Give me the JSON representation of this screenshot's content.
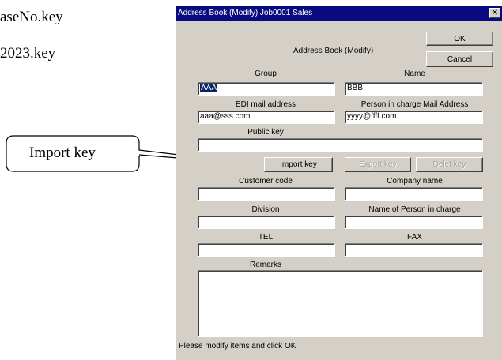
{
  "background": {
    "line1": "aseNo.key",
    "line2": "2023.key",
    "callout_label": "Import key"
  },
  "window": {
    "title": "Address Book (Modify) Job0001 Sales",
    "close_glyph": "✕",
    "heading": "Address Book (Modify)",
    "ok_label": "OK",
    "cancel_label": "Cancel"
  },
  "form": {
    "group": {
      "label": "Group",
      "value": "AAA",
      "selected": true
    },
    "name": {
      "label": "Name",
      "value": "BBB"
    },
    "edi_mail": {
      "label": "EDI mail address",
      "value": "aaa@sss.com"
    },
    "person_mail": {
      "label": "Person in charge Mail Address",
      "value": "yyyy@ffff.com"
    },
    "public_key": {
      "label": "Public key",
      "value": ""
    },
    "customer_code": {
      "label": "Customer code",
      "value": ""
    },
    "company_name": {
      "label": "Company name",
      "value": ""
    },
    "division": {
      "label": "Division",
      "value": ""
    },
    "person_in_charge": {
      "label": "Name of Person in charge",
      "value": ""
    },
    "tel": {
      "label": "TEL",
      "value": ""
    },
    "fax": {
      "label": "FAX",
      "value": ""
    },
    "remarks": {
      "label": "Remarks",
      "value": ""
    }
  },
  "key_buttons": {
    "import_label": "Import key",
    "export_label": "Export key",
    "delete_label": "Delet key"
  },
  "status_text": "Please modify items and click OK",
  "colors": {
    "titlebar": "#0a0a80",
    "window_bg": "#d4d0c8",
    "selection": "#0a246a"
  }
}
